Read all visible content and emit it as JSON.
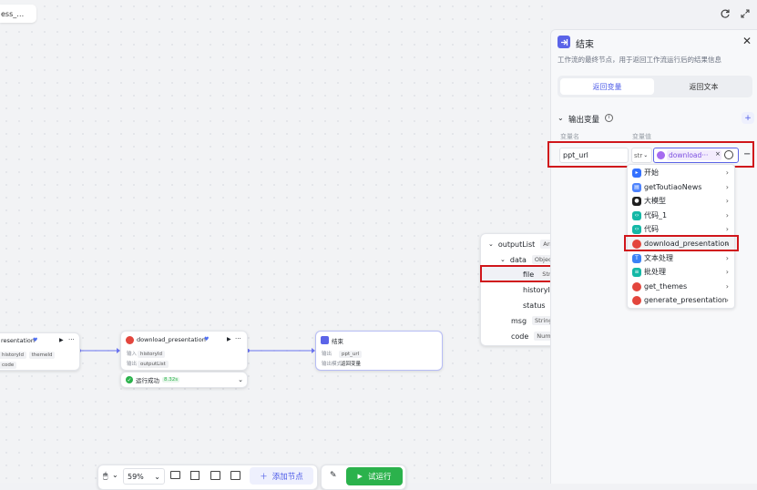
{
  "canvas": {
    "tab_title": "ess_…",
    "nodes": {
      "left_partial": {
        "title": "resentation",
        "chips": [
          "historyId",
          "themeId",
          "code"
        ]
      },
      "download": {
        "title": "download_presentation",
        "input_label": "输入",
        "input_chip": "historyId",
        "output_label": "输出",
        "output_chip": "outputList",
        "status_text": "运行成功",
        "status_time": "8.32s"
      },
      "end": {
        "title": "结束",
        "output_label": "输出",
        "output_chip": "ppt_url",
        "mode_label": "输出模式",
        "mode_value": "返回变量"
      }
    }
  },
  "toolbar": {
    "zoom": "59%",
    "add_node_label": "添加节点",
    "run_label": "试运行"
  },
  "panel": {
    "title": "结束",
    "description": "工作流的最终节点，用于返回工作流运行后的结果信息",
    "tabs": [
      {
        "label": "返回变量",
        "active": true
      },
      {
        "label": "返回文本",
        "active": false
      }
    ],
    "section_title": "输出变量",
    "col_name": "变量名",
    "col_value": "变量值",
    "var_name": "ppt_url",
    "var_type": "str",
    "var_ref": "download···"
  },
  "node_menu": {
    "items": [
      {
        "label": "开始",
        "icon": "start-icon",
        "color": "#3370ff"
      },
      {
        "label": "getToutiaoNews",
        "icon": "news-plugin-icon",
        "color": "#4e83fd"
      },
      {
        "label": "大模型",
        "icon": "llm-icon",
        "color": "#1f1f1f"
      },
      {
        "label": "代码_1",
        "icon": "code-icon",
        "color": "#14b8a6"
      },
      {
        "label": "代码",
        "icon": "code-icon",
        "color": "#14b8a6"
      },
      {
        "label": "download_presentation",
        "icon": "plugin-red-icon",
        "color": "#e3463d"
      },
      {
        "label": "文本处理",
        "icon": "text-process-icon",
        "color": "#3b82f6"
      },
      {
        "label": "批处理",
        "icon": "batch-icon",
        "color": "#14b8a6"
      },
      {
        "label": "get_themes",
        "icon": "plugin-red-icon",
        "color": "#e3463d"
      },
      {
        "label": "generate_presentation",
        "icon": "plugin-red-icon",
        "color": "#e3463d"
      }
    ]
  },
  "output_tree": {
    "rows": [
      {
        "name": "outputList",
        "type": "Array<Object>",
        "level": 0,
        "expand": true
      },
      {
        "name": "data",
        "type": "Object",
        "level": 1,
        "expand": true
      },
      {
        "name": "file",
        "type": "String",
        "level": 2,
        "expand": false
      },
      {
        "name": "historyId",
        "type": "String",
        "level": 2,
        "expand": false
      },
      {
        "name": "status",
        "type": "String",
        "level": 2,
        "expand": false
      },
      {
        "name": "msg",
        "type": "String",
        "level": 1,
        "expand": false
      },
      {
        "name": "code",
        "type": "Number",
        "level": 1,
        "expand": false
      }
    ]
  }
}
